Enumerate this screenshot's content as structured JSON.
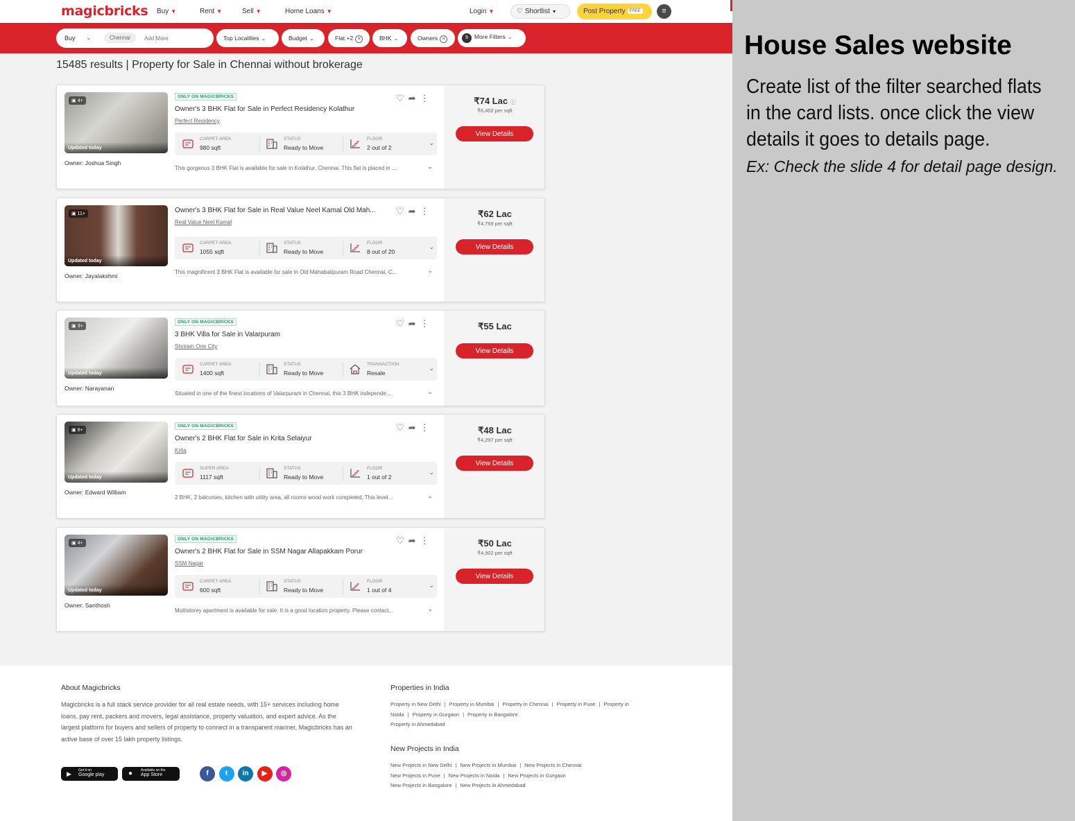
{
  "header": {
    "logo": "magicbricks",
    "nav": [
      {
        "label": "Buy"
      },
      {
        "label": "Rent"
      },
      {
        "label": "Sell"
      },
      {
        "label": "Home Loans"
      }
    ],
    "login": "Login",
    "shortlist": "Shortlist",
    "post_property": "Post Property",
    "free_badge": "FREE"
  },
  "filters": {
    "mode": "Buy",
    "city_tag": "Chennai",
    "add_more_placeholder": "Add More",
    "top_localities": "Top Localities",
    "budget": "Budget",
    "flat": "Flat +2",
    "bhk": "BHK",
    "owners": "Owners",
    "more_filters_count": "9",
    "more_filters": "More Filters"
  },
  "results_title": "15485 results | Property for Sale in Chennai without brokerage",
  "view_details_label": "View Details",
  "listings": [
    {
      "badge": "ONLY ON MAGICBRICKS",
      "title": "Owner's 3 BHK Flat for Sale in Perfect Residency Kolathur",
      "society": "Perfect Residency",
      "photos": "4+",
      "updated": "Updated today",
      "owner": "Owner: Joshua Singh",
      "area_label": "CARPET AREA",
      "area_value": "980 sqft",
      "status_label": "STATUS",
      "status_value": "Ready to Move",
      "third_label": "FLOOR",
      "third_value": "2 out of 2",
      "description": "This gorgeous 3 BHK Flat is available for sale in Kolathur, Chennai. This flat is placed in ...",
      "price": "₹74 Lac",
      "per_sqft": "₹6,452 per sqft"
    },
    {
      "badge": "",
      "title": "Owner's 3 BHK Flat for Sale in Real Value Neel Kamal Old Mah...",
      "society": "Real Value Neel Kamal",
      "photos": "11+",
      "updated": "Updated today",
      "owner": "Owner: Jayalakshmi",
      "area_label": "CARPET AREA",
      "area_value": "1055 sqft",
      "status_label": "STATUS",
      "status_value": "Ready to Move",
      "third_label": "FLOOR",
      "third_value": "8 out of 20",
      "description": "This magnificent 3 BHK Flat is available for sale in Old Mahabalipuram Road Chennai, C...",
      "price": "₹62 Lac",
      "per_sqft": "₹4,769 per sqft"
    },
    {
      "badge": "ONLY ON MAGICBRICKS",
      "title": "3 BHK Villa for Sale in Valarpuram",
      "society": "Shriram One City",
      "photos": "3+",
      "updated": "Updated today",
      "owner": "Owner: Narayanan",
      "area_label": "CARPET AREA",
      "area_value": "1400 sqft",
      "status_label": "STATUS",
      "status_value": "Ready to Move",
      "third_label": "TRANSACTION",
      "third_value": "Resale",
      "description": "Situated in one of the finest locations of Valarpuram in Chennai, this 3 BHK independe...",
      "price": "₹55 Lac",
      "per_sqft": ""
    },
    {
      "badge": "ONLY ON MAGICBRICKS",
      "title": "Owner's 2 BHK Flat for Sale in Krita Selaiyur",
      "society": "Krita",
      "photos": "6+",
      "updated": "Updated today",
      "owner": "Owner: Edward William",
      "area_label": "SUPER AREA",
      "area_value": "1117 sqft",
      "status_label": "STATUS",
      "status_value": "Ready to Move",
      "third_label": "FLOOR",
      "third_value": "1 out of 2",
      "description": "2 BHK, 2 balconies, kitchen with utility area, all rooms wood work completed, This level...",
      "price": "₹48 Lac",
      "per_sqft": "₹4,297 per sqft"
    },
    {
      "badge": "ONLY ON MAGICBRICKS",
      "title": "Owner's 2 BHK Flat for Sale in SSM Nagar Allapakkam Porur",
      "society": "SSM Nagar",
      "photos": "4+",
      "updated": "Updated today",
      "owner": "Owner: Santhosh",
      "area_label": "CARPET AREA",
      "area_value": "600 sqft",
      "status_label": "STATUS",
      "status_value": "Ready to Move",
      "third_label": "FLOOR",
      "third_value": "1 out of 4",
      "description": "Multistorey apartment is available for sale. It is a good location property. Please contact...",
      "price": "₹50 Lac",
      "per_sqft": "₹4,902 per sqft"
    }
  ],
  "footer": {
    "about_title": "About Magicbricks",
    "about_text": "Magicbricks is a full stack service provider for all real estate needs, with 15+ services including home loans, pay rent, packers and movers, legal assistance, property valuation, and expert advice. As the largest platform for buyers and sellers of property to connect in a transparent manner, Magicbricks has an active base of over 15 lakh property listings.",
    "properties_title": "Properties in India",
    "properties_links": [
      "Property in New Delhi",
      "Property in Mumbai",
      "Property in Chennai",
      "Property in Pune",
      "Property in Noida",
      "Property in Gurgaon",
      "Property in Bangalore",
      "Property in Ahmedabad"
    ],
    "projects_title": "New Projects in India",
    "projects_links": [
      "New Projects in New Delhi",
      "New Projects in Mumbai",
      "New Projects in Chennai",
      "New Projects in Pune",
      "New Projects in Noida",
      "New Projects in Gurgaon",
      "New Projects in Bangalore",
      "New Projects in Ahmedabad"
    ],
    "google_play_small": "Get it on",
    "google_play": "Google play",
    "app_store_small": "Available on the",
    "app_store": "App Store",
    "social": [
      {
        "icon": "facebook-icon",
        "glyph": "f",
        "color": "#3b5998"
      },
      {
        "icon": "twitter-icon",
        "glyph": "t",
        "color": "#1da1f2"
      },
      {
        "icon": "linkedin-icon",
        "glyph": "in",
        "color": "#0e76a8"
      },
      {
        "icon": "youtube-icon",
        "glyph": "▶",
        "color": "#e62117"
      },
      {
        "icon": "instagram-icon",
        "glyph": "◎",
        "color": "#d6249f"
      }
    ]
  },
  "side": {
    "title": "House Sales website",
    "text": "Create list of the filter searched flats in the card lists. once click the view details it goes to details page.",
    "example": "Ex: Check the slide 4 for detail page design."
  },
  "colors": {
    "brand_red": "#d8232a",
    "post_yellow": "#ffd33d",
    "badge_green": "#219a6e"
  }
}
